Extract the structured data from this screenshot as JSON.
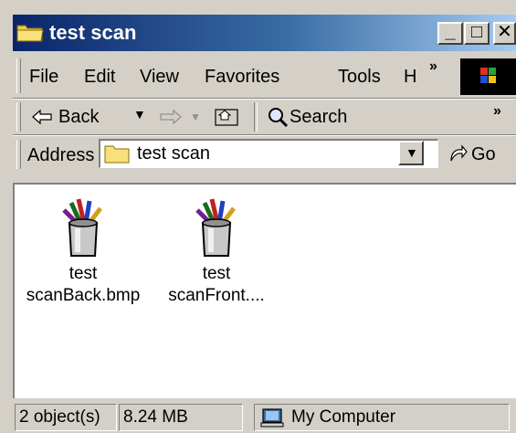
{
  "window": {
    "title": "test scan",
    "minimize_label": "_",
    "maximize_label": "□",
    "close_label": "✕"
  },
  "menu": {
    "file": "File",
    "edit": "Edit",
    "view": "View",
    "favorites": "Favorites",
    "tools": "Tools",
    "help": "H",
    "more": "»"
  },
  "toolbar": {
    "back_label": "Back",
    "search_label": "Search",
    "more": "»"
  },
  "address": {
    "label": "Address",
    "value": "test scan",
    "go_label": "Go"
  },
  "files": [
    {
      "line1": "test",
      "line2": "scanBack.bmp"
    },
    {
      "line1": "test",
      "line2": "scanFront...."
    }
  ],
  "status": {
    "objects": "2 object(s)",
    "size": "8.24 MB",
    "zone": "My Computer"
  },
  "colors": {
    "titlebar_start": "#0a246a",
    "titlebar_end": "#a6caf0",
    "chrome": "#d4d0c8"
  },
  "icons": [
    "folder-icon",
    "back-arrow-icon",
    "forward-arrow-icon",
    "up-folder-icon",
    "search-icon",
    "go-arrow-icon",
    "paint-bmp-file-icon",
    "my-computer-icon",
    "windows-logo-icon"
  ]
}
